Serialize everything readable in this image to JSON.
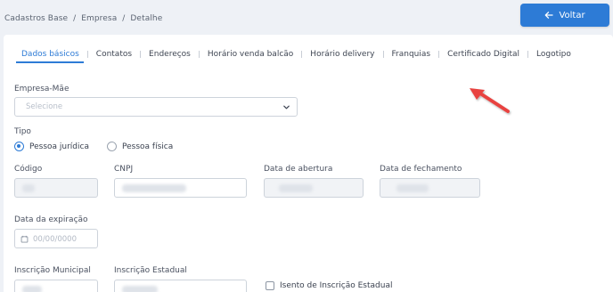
{
  "breadcrumb": {
    "item1": "Cadastros Base",
    "item2": "Empresa",
    "item3": "Detalhe",
    "separator": "/"
  },
  "back_button": {
    "label": "Voltar",
    "icon": "arrow-left-icon"
  },
  "tabs": [
    {
      "label": "Dados básicos",
      "active": true
    },
    {
      "label": "Contatos"
    },
    {
      "label": "Endereços"
    },
    {
      "label": "Horário venda balcão"
    },
    {
      "label": "Horário delivery"
    },
    {
      "label": "Franquias"
    },
    {
      "label": "Certificado Digital"
    },
    {
      "label": "Logotipo"
    }
  ],
  "form": {
    "empresa_mae": {
      "label": "Empresa-Mãe",
      "placeholder": "Selecione"
    },
    "tipo": {
      "label": "Tipo",
      "options": [
        {
          "label": "Pessoa jurídica",
          "selected": true
        },
        {
          "label": "Pessoa física",
          "selected": false
        }
      ]
    },
    "codigo": {
      "label": "Código"
    },
    "cnpj": {
      "label": "CNPJ"
    },
    "data_abertura": {
      "label": "Data de abertura"
    },
    "data_fechamento": {
      "label": "Data de fechamento"
    },
    "data_expiracao": {
      "label": "Data da expiração",
      "placeholder": "00/00/0000"
    },
    "inscricao_municipal": {
      "label": "Inscrição Municipal"
    },
    "inscricao_estadual": {
      "label": "Inscrição Estadual"
    },
    "isento": {
      "label": "Isento de Inscrição Estadual",
      "checked": false
    }
  },
  "colors": {
    "accent": "#2d7bd6",
    "annotation_arrow": "#e8423f",
    "background": "#eef1f6"
  }
}
